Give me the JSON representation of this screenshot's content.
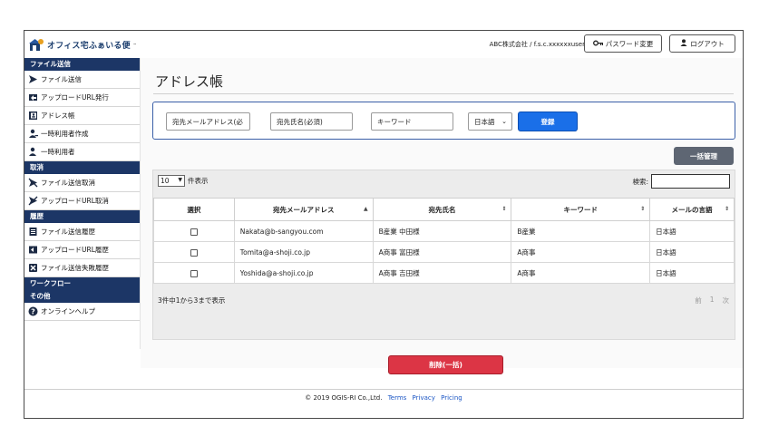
{
  "header": {
    "logo_text": "オフィス宅ふぁいる便",
    "logo_tm": "™",
    "company": "ABC株式会社 / f.s.c.xxxxxxuser",
    "password_button": "パスワード変更",
    "logout_button": "ログアウト"
  },
  "sidebar": {
    "sections": [
      {
        "title": "ファイル送信",
        "items": [
          {
            "label": "ファイル送信",
            "icon": "send-icon"
          },
          {
            "label": "アップロードURL発行",
            "icon": "upload-url-icon"
          },
          {
            "label": "アドレス帳",
            "icon": "address-book-icon"
          },
          {
            "label": "一時利用者作成",
            "icon": "add-user-icon"
          },
          {
            "label": "一時利用者",
            "icon": "user-icon"
          }
        ]
      },
      {
        "title": "取消",
        "items": [
          {
            "label": "ファイル送信取消",
            "icon": "send-cancel-icon"
          },
          {
            "label": "アップロードURL取消",
            "icon": "upload-url-cancel-icon"
          }
        ]
      },
      {
        "title": "履歴",
        "items": [
          {
            "label": "ファイル送信履歴",
            "icon": "history-icon"
          },
          {
            "label": "アップロードURL履歴",
            "icon": "upload-history-icon"
          },
          {
            "label": "ファイル送信失敗履歴",
            "icon": "failure-history-icon"
          }
        ]
      },
      {
        "title": "ワークフロー",
        "items": []
      },
      {
        "title": "その他",
        "items": [
          {
            "label": "オンラインヘルプ",
            "icon": "help-icon"
          }
        ]
      }
    ]
  },
  "main": {
    "title": "アドレス帳",
    "form": {
      "email_placeholder": "宛先メールアドレス(必",
      "name_placeholder": "宛先氏名(必須)",
      "keyword_placeholder": "キーワード",
      "language_value": "日本語",
      "register_button": "登録"
    },
    "bulk_button": "一括管理",
    "table": {
      "length_value": "10",
      "length_suffix": "件表示",
      "search_label": "検索:",
      "columns": [
        "選択",
        "宛先メールアドレス",
        "宛先氏名",
        "キーワード",
        "メールの言語"
      ],
      "rows": [
        {
          "email": "Nakata@b-sangyou.com",
          "name": "B産業 中田様",
          "keyword": "B産業",
          "language": "日本語"
        },
        {
          "email": "Tomita@a-shoji.co.jp",
          "name": "A商事 富田様",
          "keyword": "A商事",
          "language": "日本語"
        },
        {
          "email": "Yoshida@a-shoji.co.jp",
          "name": "A商事 吉田様",
          "keyword": "A商事",
          "language": "日本語"
        }
      ],
      "info": "3件中1から3まで表示",
      "pager": {
        "prev": "前",
        "page": "1",
        "next": "次"
      }
    },
    "delete_button": "削除(一括)"
  },
  "footer": {
    "copyright": "© 2019 OGIS-RI Co.,Ltd.",
    "links": [
      "Terms",
      "Privacy",
      "Pricing"
    ]
  },
  "colors": {
    "sidebar_header": "#1c3666",
    "register": "#1a6fe8",
    "delete": "#dc3545",
    "bulk": "#5e6673",
    "link": "#1a55c4"
  }
}
